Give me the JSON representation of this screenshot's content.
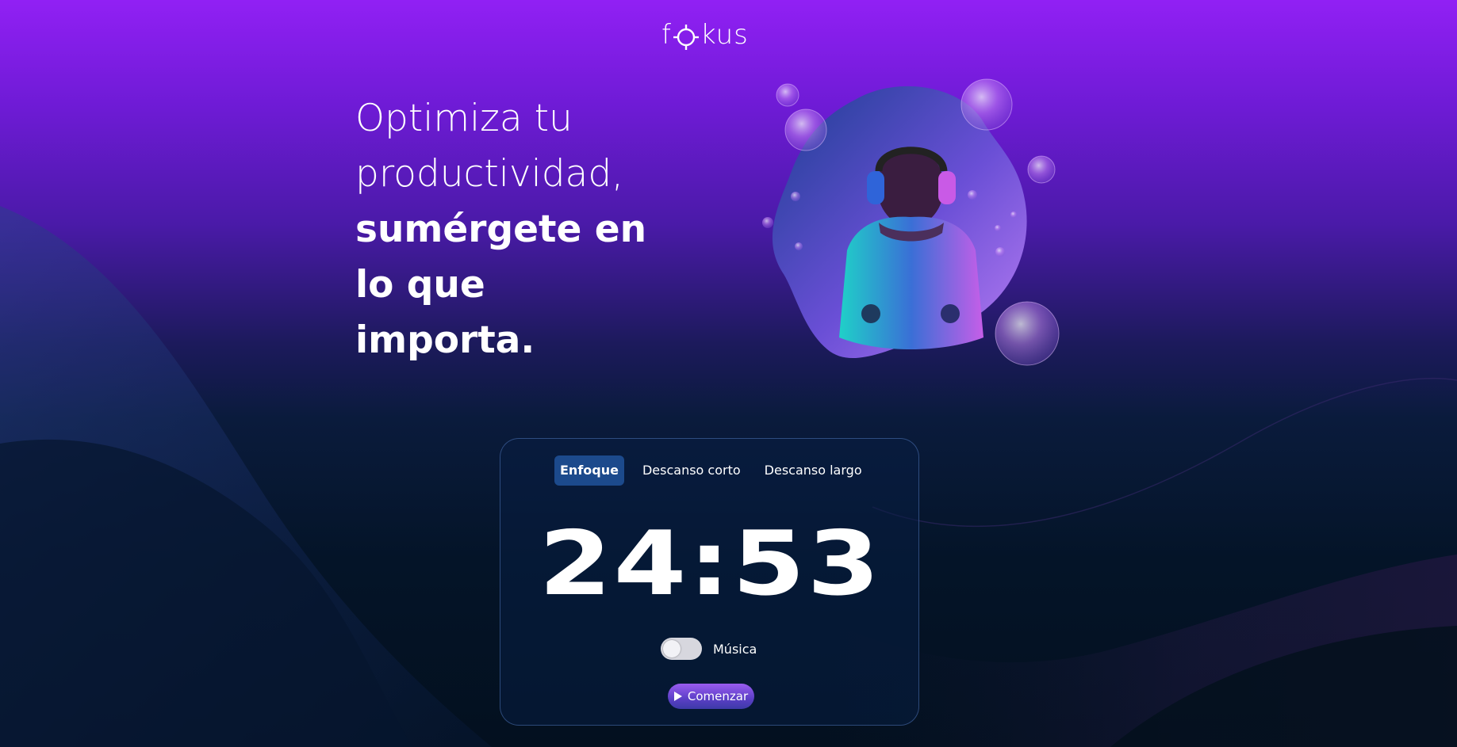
{
  "brand": {
    "logo_prefix": "f",
    "logo_suffix": "kus"
  },
  "hero": {
    "title_light_1": "Optimiza tu",
    "title_light_2": "productividad,",
    "title_bold_1": "sumérgete en",
    "title_bold_2": "lo que",
    "title_bold_3": "importa.",
    "image": "person-with-headphones-illustration"
  },
  "timer": {
    "tabs": [
      {
        "label": "Enfoque",
        "active": true
      },
      {
        "label": "Descanso corto",
        "active": false
      },
      {
        "label": "Descanso largo",
        "active": false
      }
    ],
    "time": "24:53",
    "music": {
      "label": "Música",
      "enabled": false
    },
    "start_button": {
      "label": "Comenzar",
      "icon": "play-icon"
    }
  },
  "colors": {
    "accent_purple": "#9120f4",
    "tab_active": "#1c4a8c",
    "button_start": "#9a5cf0",
    "background_dark": "#041428"
  }
}
